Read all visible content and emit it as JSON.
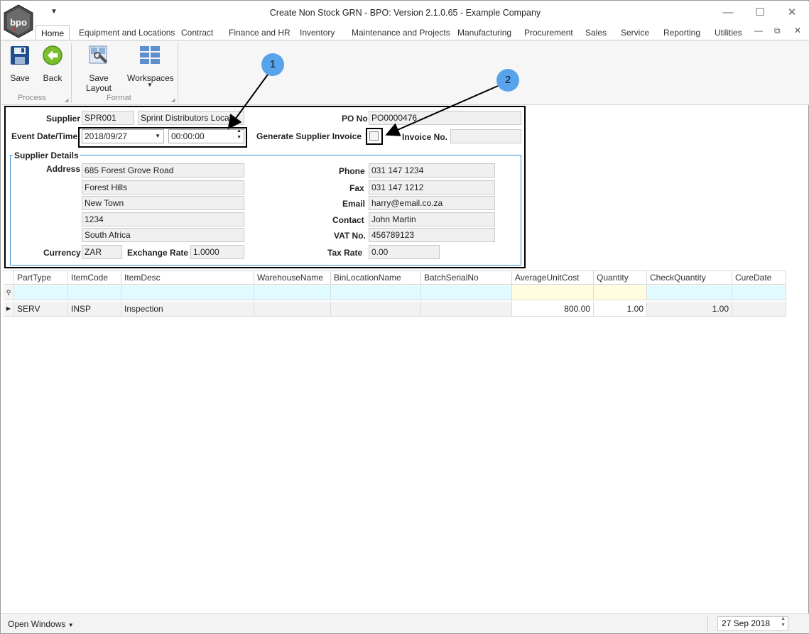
{
  "app": {
    "title": "Create Non Stock GRN - BPO: Version 2.1.0.65 - Example Company",
    "logo_text": "bpo"
  },
  "tabs": [
    {
      "label": "Home",
      "active": true
    },
    {
      "label": "Equipment and Locations"
    },
    {
      "label": "Contract"
    },
    {
      "label": "Finance and HR"
    },
    {
      "label": "Inventory"
    },
    {
      "label": "Maintenance and Projects"
    },
    {
      "label": "Manufacturing"
    },
    {
      "label": "Procurement"
    },
    {
      "label": "Sales"
    },
    {
      "label": "Service"
    },
    {
      "label": "Reporting"
    },
    {
      "label": "Utilities"
    }
  ],
  "ribbon": {
    "save": "Save",
    "back": "Back",
    "save_layout": "Save Layout",
    "workspaces": "Workspaces",
    "group_process": "Process",
    "group_format": "Format"
  },
  "form": {
    "supplier_label": "Supplier",
    "supplier_code": "SPR001",
    "supplier_name": "Sprint Distributors Local",
    "po_label": "PO No",
    "po_no": "PO0000476",
    "event_label": "Event Date/Time",
    "event_date": "2018/09/27",
    "event_time": "00:00:00",
    "gen_invoice_label": "Generate Supplier Invoice",
    "gen_invoice_checked": false,
    "invoice_no_label": "Invoice No.",
    "invoice_no": ""
  },
  "supplier_details": {
    "title": "Supplier Details",
    "address_label": "Address",
    "address": [
      "685 Forest Grove Road",
      "Forest Hills",
      "New Town",
      "1234",
      "South Africa"
    ],
    "phone_label": "Phone",
    "phone": "031 147 1234",
    "fax_label": "Fax",
    "fax": "031 147 1212",
    "email_label": "Email",
    "email": "harry@email.co.za",
    "contact_label": "Contact",
    "contact": "John Martin",
    "vat_label": "VAT No.",
    "vat": "456789123",
    "currency_label": "Currency",
    "currency": "ZAR",
    "exchange_label": "Exchange Rate",
    "exchange_rate": "1.0000",
    "tax_label": "Tax Rate",
    "tax_rate": "0.00"
  },
  "callouts": [
    "1",
    "2"
  ],
  "grid": {
    "columns": [
      "PartType",
      "ItemCode",
      "ItemDesc",
      "WarehouseName",
      "BinLocationName",
      "BatchSerialNo",
      "AverageUnitCost",
      "Quantity",
      "CheckQuantity",
      "CureDate"
    ],
    "rows": [
      {
        "PartType": "SERV",
        "ItemCode": "INSP",
        "ItemDesc": "Inspection",
        "WarehouseName": "",
        "BinLocationName": "",
        "BatchSerialNo": "",
        "AverageUnitCost": "800.00",
        "Quantity": "1.00",
        "CheckQuantity": "1.00",
        "CureDate": ""
      }
    ]
  },
  "status": {
    "open_windows": "Open Windows",
    "date": "27 Sep 2018"
  },
  "colors": {
    "accent": "#3a8ed6",
    "callout": "#57a3ec",
    "filter_row": "#dffbff",
    "filter_row_yellow": "#fffce0"
  }
}
